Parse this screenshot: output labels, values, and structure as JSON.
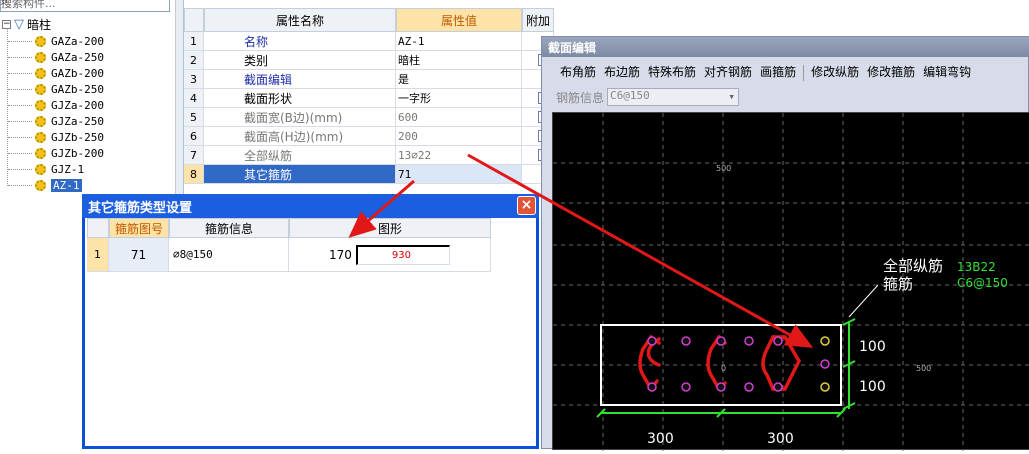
{
  "tree": {
    "search_placeholder": "搜索构件...",
    "root_label": "暗柱",
    "items": [
      "GAZa-200",
      "GAZa-250",
      "GAZb-200",
      "GAZb-250",
      "GJZa-200",
      "GJZa-250",
      "GJZb-250",
      "GJZb-200",
      "GJZ-1",
      "AZ-1"
    ]
  },
  "grid": {
    "col_name": "属性名称",
    "col_value": "属性值",
    "col_extra": "附加",
    "rows": [
      {
        "n": "1",
        "name": "名称",
        "value": "AZ-1"
      },
      {
        "n": "2",
        "name": "类别",
        "value": "暗柱"
      },
      {
        "n": "3",
        "name": "截面编辑",
        "value": "是"
      },
      {
        "n": "4",
        "name": "截面形状",
        "value": "一字形"
      },
      {
        "n": "5",
        "name": "截面宽(B边)(mm)",
        "value": "600"
      },
      {
        "n": "6",
        "name": "截面高(H边)(mm)",
        "value": "200"
      },
      {
        "n": "7",
        "name": "全部纵筋",
        "value": "13⌀22"
      },
      {
        "n": "8",
        "name": "其它箍筋",
        "value": "71"
      }
    ]
  },
  "dialog": {
    "title": "其它箍筋类型设置",
    "col_no": "箍筋图号",
    "col_info": "箍筋信息",
    "col_shape": "图形",
    "row": {
      "n": "1",
      "no": "71",
      "info": "⌀8@150",
      "left": "170",
      "inner": "930"
    }
  },
  "editor": {
    "title": "截面编辑",
    "toolbar": [
      "布角筋",
      "布边筋",
      "特殊布筋",
      "对齐钢筋",
      "画箍筋",
      "修改纵筋",
      "修改箍筋",
      "编辑弯钩"
    ],
    "rebar_info_label": "钢筋信息",
    "rebar_info_value": "C6@150",
    "canvas": {
      "label_all": "全部纵筋",
      "label_stirrup": "箍筋",
      "val_all": "13B22",
      "val_stirrup": "C6@150",
      "dim_h1": "100",
      "dim_h2": "100",
      "dim_w1": "300",
      "dim_w2": "300",
      "grid_label_1": "500",
      "grid_label_2": "500",
      "origin": "0"
    }
  }
}
